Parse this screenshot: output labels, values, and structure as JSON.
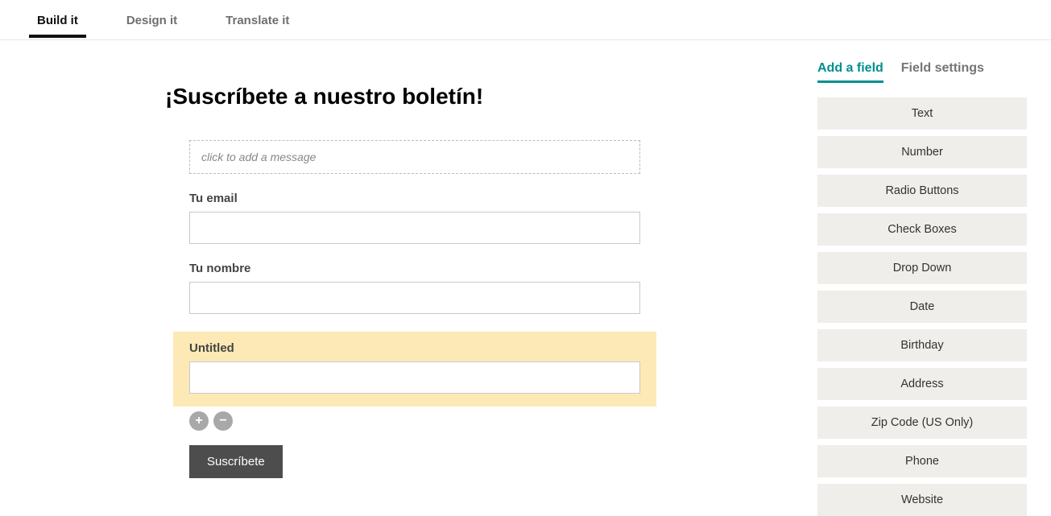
{
  "tabs": {
    "build": "Build it",
    "design": "Design it",
    "translate": "Translate it"
  },
  "form": {
    "title": "¡Suscríbete a nuestro boletín!",
    "message_placeholder": "click to add a message",
    "fields": [
      {
        "label": "Tu email"
      },
      {
        "label": "Tu nombre"
      }
    ],
    "selected_field": {
      "label": "Untitled"
    },
    "submit_label": "Suscríbete"
  },
  "sidebar": {
    "tabs": {
      "add": "Add a field",
      "settings": "Field settings"
    },
    "field_types": [
      "Text",
      "Number",
      "Radio Buttons",
      "Check Boxes",
      "Drop Down",
      "Date",
      "Birthday",
      "Address",
      "Zip Code (US Only)",
      "Phone",
      "Website"
    ]
  },
  "icons": {
    "plus": "+",
    "minus": "−"
  }
}
